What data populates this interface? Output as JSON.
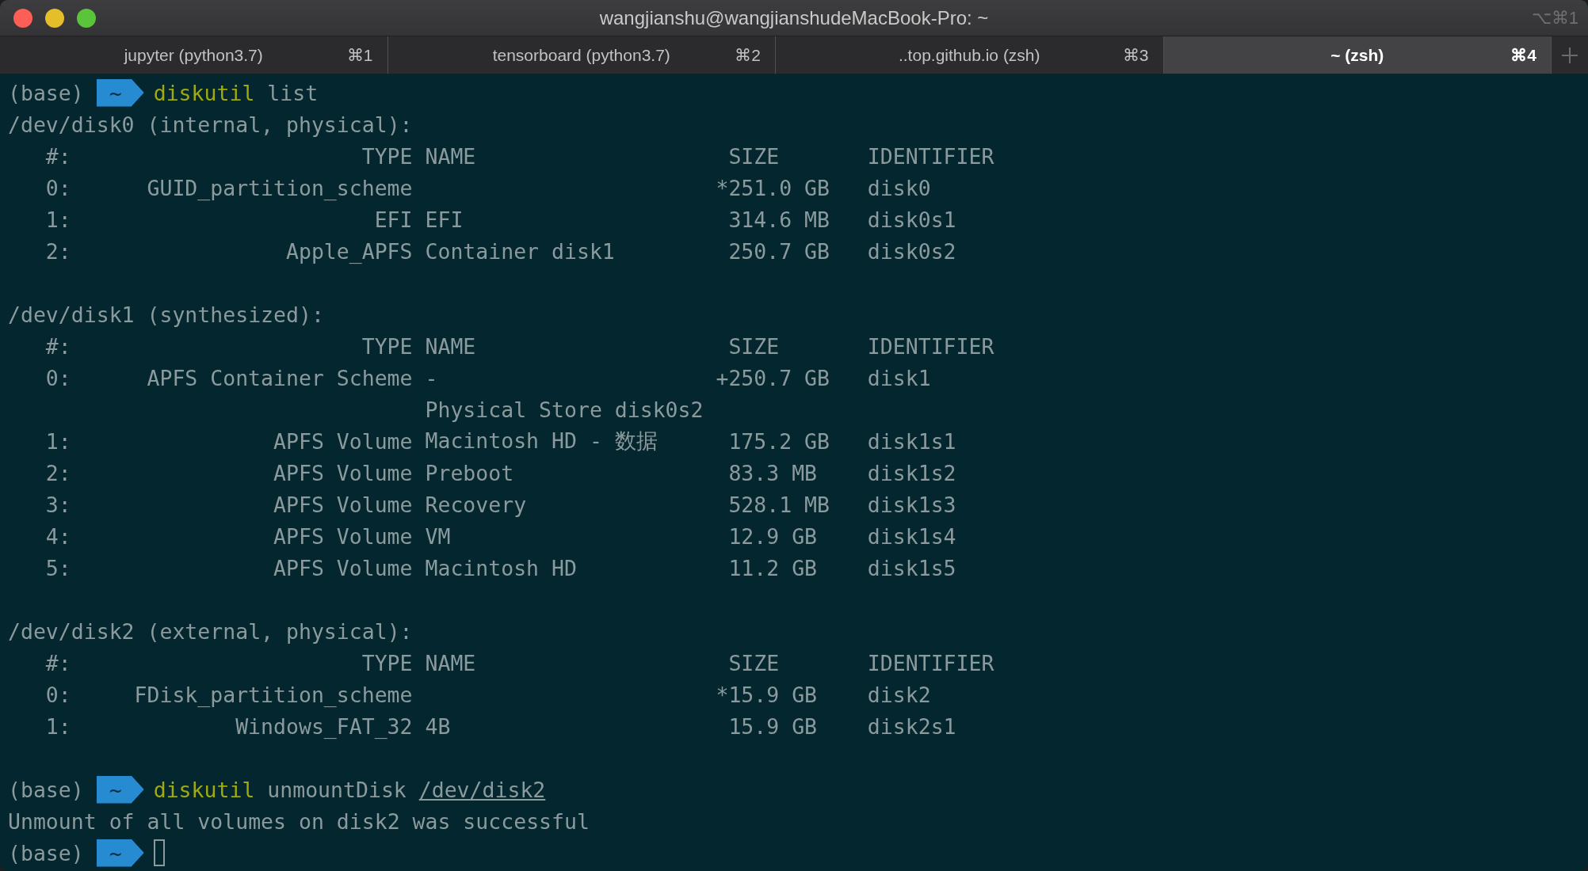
{
  "window": {
    "title": "wangjianshu@wangjianshudeMacBook-Pro: ~",
    "shortcut": "⌥⌘1"
  },
  "tabs": [
    {
      "label": "jupyter (python3.7)",
      "shortcut": "⌘1",
      "selected": false
    },
    {
      "label": "tensorboard (python3.7)",
      "shortcut": "⌘2",
      "selected": false
    },
    {
      "label": "..top.github.io (zsh)",
      "shortcut": "⌘3",
      "selected": false
    },
    {
      "label": "~ (zsh)",
      "shortcut": "⌘4",
      "selected": true
    }
  ],
  "terminal": {
    "lines": [
      {
        "kind": "prompt",
        "env": "(base)",
        "dir": "~",
        "command": "diskutil",
        "args": [
          {
            "text": "list",
            "underlined": false
          }
        ],
        "cursor": false
      },
      {
        "kind": "text",
        "text": "/dev/disk0 (internal, physical):"
      },
      {
        "kind": "row",
        "index": "#:",
        "type": "TYPE",
        "name": "NAME",
        "size": "SIZE",
        "identifier": "IDENTIFIER"
      },
      {
        "kind": "row",
        "index": "0:",
        "type": "GUID_partition_scheme",
        "marker": "*",
        "size": "251.0 GB",
        "identifier": "disk0"
      },
      {
        "kind": "row",
        "index": "1:",
        "type": "EFI",
        "name": "EFI",
        "size": "314.6 MB",
        "identifier": "disk0s1"
      },
      {
        "kind": "row",
        "index": "2:",
        "type": "Apple_APFS",
        "name": "Container disk1",
        "size": "250.7 GB",
        "identifier": "disk0s2"
      },
      {
        "kind": "blank"
      },
      {
        "kind": "text",
        "text": "/dev/disk1 (synthesized):"
      },
      {
        "kind": "row",
        "index": "#:",
        "type": "TYPE",
        "name": "NAME",
        "size": "SIZE",
        "identifier": "IDENTIFIER"
      },
      {
        "kind": "row",
        "index": "0:",
        "type": "APFS Container Scheme",
        "name": "-",
        "marker": "+",
        "size": "250.7 GB",
        "identifier": "disk1"
      },
      {
        "kind": "row",
        "name": "Physical Store disk0s2"
      },
      {
        "kind": "row",
        "index": "1:",
        "type": "APFS Volume",
        "name": "Macintosh HD - 数据",
        "size": "175.2 GB",
        "identifier": "disk1s1"
      },
      {
        "kind": "row",
        "index": "2:",
        "type": "APFS Volume",
        "name": "Preboot",
        "size": "83.3 MB",
        "identifier": "disk1s2"
      },
      {
        "kind": "row",
        "index": "3:",
        "type": "APFS Volume",
        "name": "Recovery",
        "size": "528.1 MB",
        "identifier": "disk1s3"
      },
      {
        "kind": "row",
        "index": "4:",
        "type": "APFS Volume",
        "name": "VM",
        "size": "12.9 GB",
        "identifier": "disk1s4"
      },
      {
        "kind": "row",
        "index": "5:",
        "type": "APFS Volume",
        "name": "Macintosh HD",
        "size": "11.2 GB",
        "identifier": "disk1s5"
      },
      {
        "kind": "blank"
      },
      {
        "kind": "text",
        "text": "/dev/disk2 (external, physical):"
      },
      {
        "kind": "row",
        "index": "#:",
        "type": "TYPE",
        "name": "NAME",
        "size": "SIZE",
        "identifier": "IDENTIFIER"
      },
      {
        "kind": "row",
        "index": "0:",
        "type": "FDisk_partition_scheme",
        "marker": "*",
        "size": "15.9 GB",
        "identifier": "disk2"
      },
      {
        "kind": "row",
        "index": "1:",
        "type": "Windows_FAT_32",
        "name": "4B",
        "size": "15.9 GB",
        "identifier": "disk2s1"
      },
      {
        "kind": "blank"
      },
      {
        "kind": "prompt",
        "env": "(base)",
        "dir": "~",
        "command": "diskutil",
        "args": [
          {
            "text": "unmountDisk",
            "underlined": false
          },
          {
            "text": "/dev/disk2",
            "underlined": true
          }
        ],
        "cursor": false
      },
      {
        "kind": "text",
        "text": "Unmount of all volumes on disk2 was successful"
      },
      {
        "kind": "prompt",
        "env": "(base)",
        "dir": "~",
        "cursor": true
      }
    ]
  }
}
